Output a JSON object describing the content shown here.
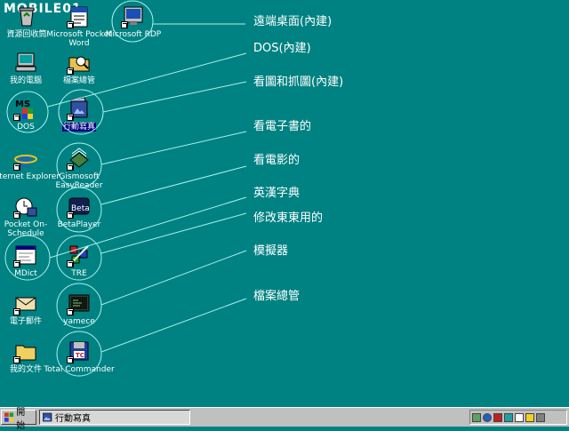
{
  "logo": {
    "text": "MOBILE01"
  },
  "desktop_icons": [
    {
      "id": "recycle",
      "label": "資源回收筒",
      "shortcut": false,
      "icon": "recycle-bin-icon",
      "color": "#808080"
    },
    {
      "id": "pword",
      "label": "Microsoft Pocket Word",
      "shortcut": true,
      "icon": "word-icon",
      "color": "#1a4fb5"
    },
    {
      "id": "rdp",
      "label": "Microsoft RDP",
      "shortcut": true,
      "icon": "rdp-icon",
      "color": "#c0c0c0"
    },
    {
      "id": "mycomp",
      "label": "我的電腦",
      "shortcut": false,
      "icon": "computer-icon",
      "color": "#c0c0c0"
    },
    {
      "id": "explorer",
      "label": "檔案總管",
      "shortcut": true,
      "icon": "explorer-icon",
      "color": "#e8c050"
    },
    {
      "id": "dos",
      "label": "DOS",
      "shortcut": true,
      "icon": "msdos-icon",
      "color": "#000000"
    },
    {
      "id": "photo",
      "label": "行動寫真",
      "shortcut": true,
      "icon": "photo-icon",
      "color": "#3050a0",
      "selected": true
    },
    {
      "id": "ie",
      "label": "Internet Explorer",
      "shortcut": true,
      "icon": "ie-icon",
      "color": "#2060c0"
    },
    {
      "id": "gismo",
      "label": "Gismosoft EasyReader",
      "shortcut": true,
      "icon": "ebook-reader-icon",
      "color": "#408040"
    },
    {
      "id": "pos",
      "label": "Pocket On-Schedule",
      "shortcut": true,
      "icon": "calendar-clock-icon",
      "color": "#3050a0"
    },
    {
      "id": "beta",
      "label": "BetaPlayer",
      "shortcut": true,
      "icon": "video-player-icon",
      "color": "#102050"
    },
    {
      "id": "mdict",
      "label": "MDict",
      "shortcut": true,
      "icon": "dictionary-window-icon",
      "color": "#ffffff"
    },
    {
      "id": "tre",
      "label": "TRE",
      "shortcut": true,
      "icon": "registry-editor-icon",
      "color": "#c02020"
    },
    {
      "id": "mail",
      "label": "電子郵件",
      "shortcut": true,
      "icon": "mail-icon",
      "color": "#f0e0b0"
    },
    {
      "id": "yamece",
      "label": "yamece",
      "shortcut": true,
      "icon": "emulator-icon",
      "color": "#304030"
    },
    {
      "id": "docs",
      "label": "我的文件",
      "shortcut": true,
      "icon": "folder-icon",
      "color": "#f0d060"
    },
    {
      "id": "total",
      "label": "Total Commander",
      "shortcut": true,
      "icon": "total-commander-icon",
      "color": "#2040a0"
    }
  ],
  "annotations": [
    {
      "id": "rdp",
      "text": "遠端桌面(內建)"
    },
    {
      "id": "dos",
      "text": "DOS(內建)"
    },
    {
      "id": "photo",
      "text": "看圖和抓圖(內建)"
    },
    {
      "id": "gismo",
      "text": "看電子書的"
    },
    {
      "id": "beta",
      "text": "看電影的"
    },
    {
      "id": "mdict",
      "text": "英漢字典"
    },
    {
      "id": "tre",
      "text": "修改東東用的"
    },
    {
      "id": "yamece",
      "text": "模擬器"
    },
    {
      "id": "total",
      "text": "檔案總管"
    }
  ],
  "taskbar": {
    "start_label": "開始",
    "active_task": "行動寫真",
    "tray_icons": [
      "network-icon",
      "ie-icon",
      "stop-icon",
      "sync-icon",
      "cursor-icon",
      "star-icon",
      "keyboard-icon"
    ]
  },
  "colors": {
    "desktop": "#008282",
    "circle": "#aaf0f0",
    "taskbar": "#c0c0c0"
  }
}
